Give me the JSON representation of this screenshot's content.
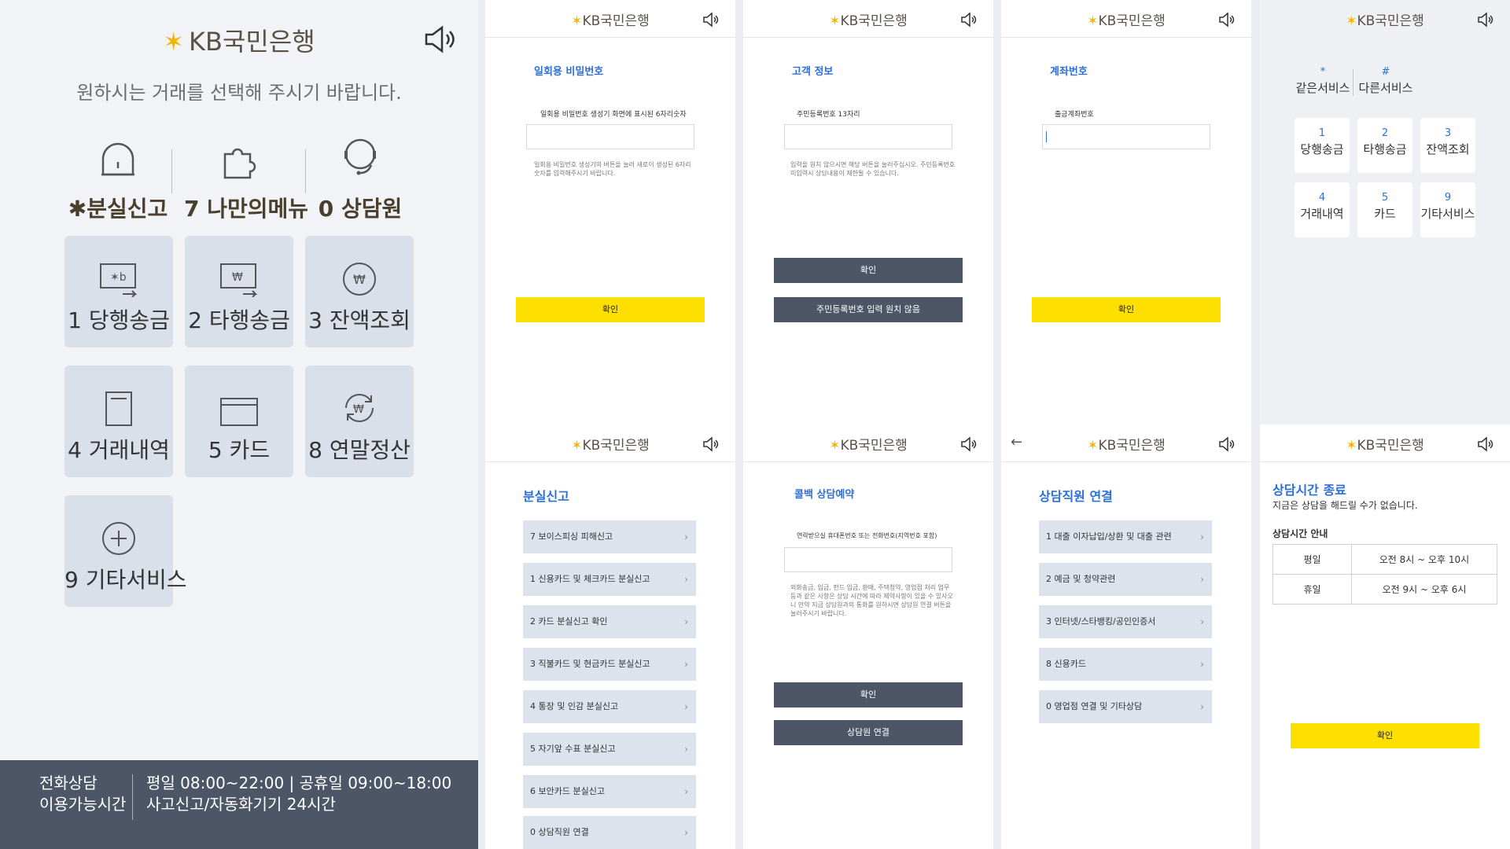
{
  "main": {
    "brand": "KB국민은행",
    "subtitle": "원하시는 거래를 선택해 주시기 바랍니다.",
    "quick": [
      "✱분실신고",
      "7 나만의메뉴",
      "0 상담원"
    ],
    "tiles": [
      "1 당행송금",
      "2 타행송금",
      "3 잔액조회",
      "4 거래내역",
      "5 카드",
      "8 연말정산",
      "9 기타서비스"
    ],
    "hours": {
      "title1": "전화상담",
      "title2": "이용가능시간",
      "line1": "평일 08:00~22:00 | 공휴일 09:00~18:00",
      "line2": "사고신고/자동화기기 24시간"
    }
  },
  "brand_small": "KB국민은행",
  "otp": {
    "title": "일회용 비밀번호",
    "label": "일회용 비밀번호 생성기 화면에 표시된 6자리숫자",
    "help": "일회용 비밀번호 생성기의 버튼을 눌러 새로이 생성된 6자리 숫자를 입력해주시기 바랍니다.",
    "confirm": "확인"
  },
  "customer": {
    "title": "고객 정보",
    "label": "주민등록번호 13자리",
    "help": "입력을 원치 않으시면 해당 버튼을 눌러주십시오. 주민등록번호 미입력시 상담내용이 제한될 수 있습니다.",
    "confirm": "확인",
    "skip": "주민등록번호 입력 원치 않음"
  },
  "account": {
    "title": "계좌번호",
    "label": "출금계좌번호",
    "confirm": "확인"
  },
  "keypad": {
    "top": [
      {
        "n": "*",
        "l": "같은서비스"
      },
      {
        "n": "#",
        "l": "다른서비스"
      }
    ],
    "keys": [
      {
        "n": "1",
        "l": "당행송금"
      },
      {
        "n": "2",
        "l": "타행송금"
      },
      {
        "n": "3",
        "l": "잔액조회"
      },
      {
        "n": "4",
        "l": "거래내역"
      },
      {
        "n": "5",
        "l": "카드"
      },
      {
        "n": "9",
        "l": "기타서비스"
      }
    ]
  },
  "lost": {
    "title": "분실신고",
    "items": [
      "7 보이스피싱 피해신고",
      "1 신용카드 및 체크카드 분실신고",
      "2 카드 분실신고 확인",
      "3 직불카드 및 현금카드 분실신고",
      "4 통장 및 인감 분실신고",
      "5 자기앞 수표 분실신고",
      "6 보안카드 분실신고",
      "0 상담직원 연결"
    ]
  },
  "callback": {
    "title": "콜백 상담예약",
    "label": "연락받으실 휴대폰번호 또는 전화번호(지역번호 포함)",
    "help": "외화송금, 입금, 펀드 입금, 환매, 주택청약, 영업점 처리 업무 등과 같은 사항은 상담 시간에 따라 제약사항이 있을 수 있사오니 만약 지금 상담원과의 통화를 원하시면 상담원 연결 버튼을 눌러주시기 바랍니다.",
    "confirm": "확인",
    "connect": "상담원 연결"
  },
  "agent": {
    "title": "상담직원 연결",
    "items": [
      "1 대출 이자납입/상환 및 대출 관련",
      "2 예금 및 청약관련",
      "3 인터넷/스타뱅킹/공인인증서",
      "8 신용카드",
      "0 영업점 연결 및 기타상담"
    ]
  },
  "closed": {
    "title": "상담시간 종료",
    "msg": "지금은 상담을 해드릴 수가 없습니다.",
    "sub": "상담시간 안내",
    "rows": [
      [
        "평일",
        "오전 8시 ~ 오후 10시"
      ],
      [
        "휴일",
        "오전 9시 ~ 오후 6시"
      ]
    ],
    "confirm": "확인"
  }
}
